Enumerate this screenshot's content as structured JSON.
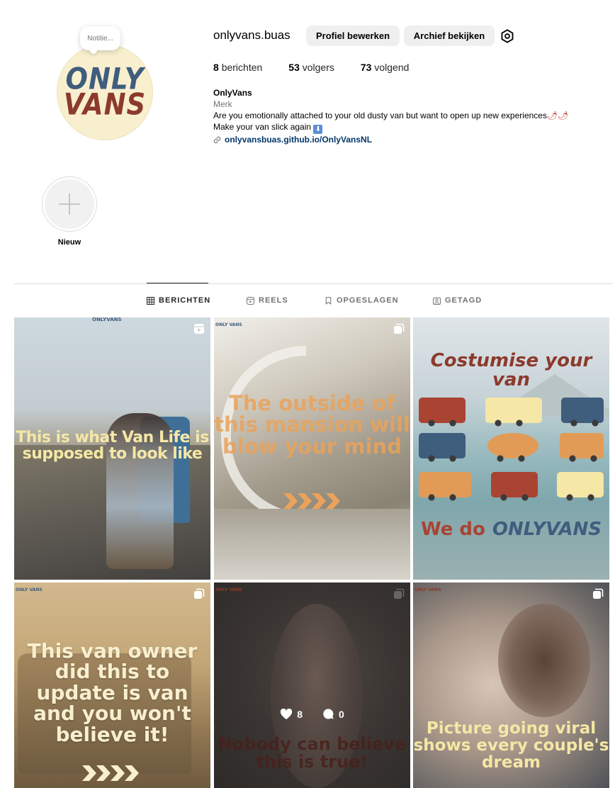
{
  "profile": {
    "note": "Notitie...",
    "avatar_line1": "ONLY",
    "avatar_line2": "VANS",
    "username": "onlyvans.buas",
    "edit_button": "Profiel bewerken",
    "archive_button": "Archief bekijken",
    "stats": {
      "posts_count": "8",
      "posts_label": "berichten",
      "followers_count": "53",
      "followers_label": "volgers",
      "following_count": "73",
      "following_label": "volgend"
    },
    "bio": {
      "name": "OnlyVans",
      "category": "Merk",
      "line1": "Are you emotionally attached to your old dusty van but want to open up new experiences",
      "line1_emoji": "🌶🌶",
      "line2": "Make your van slick again",
      "line2_emoji": "⬇",
      "link": "onlyvansbuas.github.io/OnlyVansNL"
    }
  },
  "highlight": {
    "label": "Nieuw"
  },
  "tabs": [
    {
      "label": "BERICHTEN",
      "icon": "grid-icon",
      "active": true
    },
    {
      "label": "REELS",
      "icon": "reels-icon",
      "active": false
    },
    {
      "label": "OPGESLAGEN",
      "icon": "bookmark-icon",
      "active": false
    },
    {
      "label": "GETAGD",
      "icon": "tagged-icon",
      "active": false
    }
  ],
  "posts": [
    {
      "text": "This is what Van Life is supposed to look like",
      "logo": "ONLYVANS",
      "type": "reel"
    },
    {
      "text": "The outside of this mansion will blow your mind",
      "logo": "ONLY VANS",
      "type": "carousel"
    },
    {
      "text_top": "Costumise your van",
      "text_bottom_prefix": "We do",
      "text_bottom_brand": "ONLYVANS",
      "type": "none"
    },
    {
      "text": "This van owner did this to update is van and you won't believe it!",
      "logo": "ONLY VANS",
      "type": "carousel"
    },
    {
      "text": "Nobody can believe this is true!",
      "logo": "ONLY VANS",
      "likes": "8",
      "comments": "0",
      "type": "carousel"
    },
    {
      "text": "Picture going viral shows every couple's dream",
      "logo": "ONLY VANS",
      "type": "carousel"
    }
  ],
  "colors": {
    "brand_blue": "#3f5d7d",
    "brand_red": "#8c3a2c",
    "brand_cream": "#f8efcf",
    "link_blue": "#00376b",
    "button_gray": "#efefef"
  }
}
